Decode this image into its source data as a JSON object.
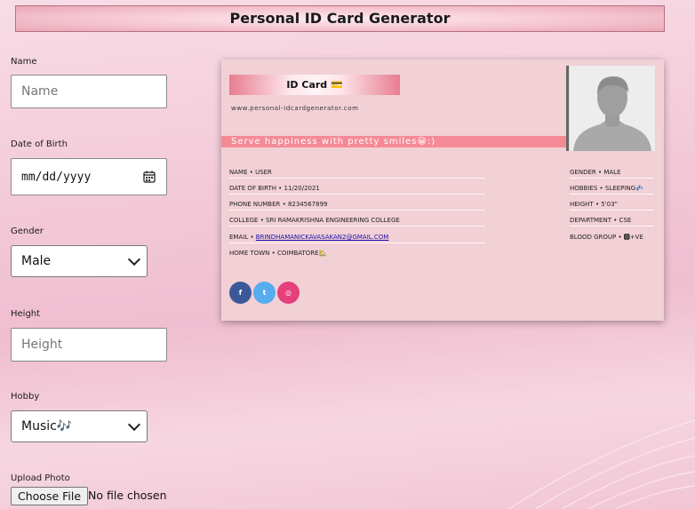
{
  "page": {
    "title": "Personal ID Card Generator"
  },
  "form": {
    "name": {
      "label": "Name",
      "placeholder": "Name"
    },
    "dob": {
      "label": "Date of Birth",
      "placeholder": "mm/dd/yyyy"
    },
    "gender": {
      "label": "Gender",
      "value": "Male"
    },
    "height": {
      "label": "Height",
      "placeholder": "Height"
    },
    "hobby": {
      "label": "Hobby",
      "value": "Music🎶"
    },
    "photo": {
      "label": "Upload Photo",
      "button": "Choose File",
      "status": "No file chosen"
    }
  },
  "card": {
    "title": "ID Card 💳",
    "url": "www.personal-idcardgenerator.com",
    "tagline": "Serve happiness with pretty smiles😀:)",
    "left_rows": [
      "NAME • USER",
      "DATE OF BIRTH • 11/20/2021",
      "PHONE NUMBER • 8234567899",
      "COLLEGE • SRI RAMAKRISHNA ENGINEERING COLLEGE",
      "EMAIL • ",
      "HOME TOWN • COIMBATORE🏡"
    ],
    "email_link": "BRINDHAMANICKAVASAKAN2@GMAIL.COM",
    "right_rows": [
      "GENDER • MALE",
      "HOBBIES • SLEEPING💤",
      "HEIGHT • 5'03\"",
      "DEPARTMENT • CSE",
      "BLOOD GROUP • 🅾+VE"
    ],
    "social": {
      "facebook": "f",
      "twitter": "t",
      "instagram": "◎"
    }
  },
  "colors": {
    "tagline_bg": "#f58a96",
    "facebook": "#3b5998",
    "twitter": "#55acee",
    "instagram": "#e4407b"
  }
}
